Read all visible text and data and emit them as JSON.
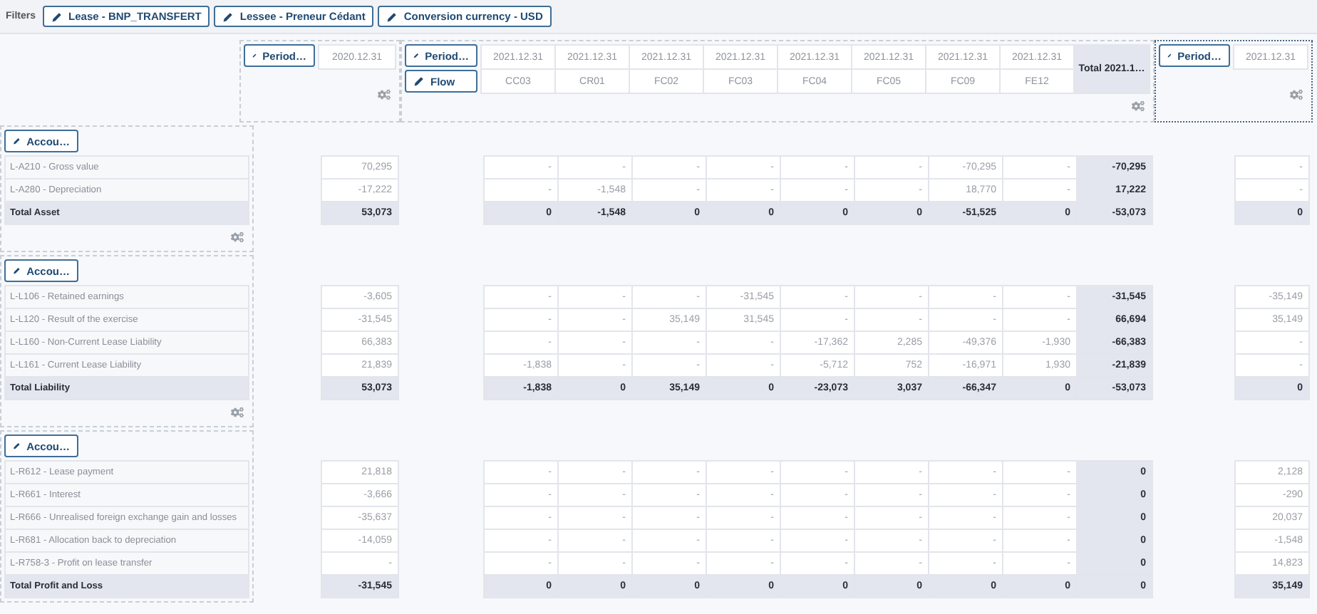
{
  "filters": {
    "label": "Filters",
    "chips": [
      {
        "label": "Lease - BNP_TRANSFERT"
      },
      {
        "label": "Lessee - Preneur Cédant"
      },
      {
        "label": "Conversion currency - USD"
      }
    ]
  },
  "column_header": {
    "block_a": {
      "buttons": [
        "Period…"
      ],
      "cells": [
        "2020.12.31"
      ],
      "selected": false
    },
    "block_b": {
      "buttons": [
        "Period…",
        "Flow"
      ],
      "columns": [
        {
          "period": "2021.12.31",
          "flow": "CC03"
        },
        {
          "period": "2021.12.31",
          "flow": "CR01"
        },
        {
          "period": "2021.12.31",
          "flow": "FC02"
        },
        {
          "period": "2021.12.31",
          "flow": "FC03"
        },
        {
          "period": "2021.12.31",
          "flow": "FC04"
        },
        {
          "period": "2021.12.31",
          "flow": "FC05"
        },
        {
          "period": "2021.12.31",
          "flow": "FC09"
        },
        {
          "period": "2021.12.31",
          "flow": "FE12"
        }
      ],
      "total": "Total 2021.1…",
      "selected": false
    },
    "block_c": {
      "buttons": [
        "Period…"
      ],
      "cells": [
        "2021.12.31"
      ],
      "selected": true
    }
  },
  "sections": [
    {
      "button": "Accou…",
      "settings_icon": true,
      "rows": [
        {
          "kind": "row",
          "label": "L-A210 - Gross value",
          "a": "70,295",
          "b": [
            "-",
            "-",
            "-",
            "-",
            "-",
            "-",
            "-70,295",
            "-"
          ],
          "total": "-70,295",
          "c": "-"
        },
        {
          "kind": "row",
          "label": "L-A280 - Depreciation",
          "a": "-17,222",
          "b": [
            "-",
            "-1,548",
            "-",
            "-",
            "-",
            "-",
            "18,770",
            "-"
          ],
          "total": "17,222",
          "c": "-"
        },
        {
          "kind": "total",
          "label": "Total Asset",
          "a": "53,073",
          "b": [
            "0",
            "-1,548",
            "0",
            "0",
            "0",
            "0",
            "-51,525",
            "0"
          ],
          "total": "-53,073",
          "c": "0"
        }
      ]
    },
    {
      "button": "Accou…",
      "settings_icon": true,
      "rows": [
        {
          "kind": "row",
          "label": "L-L106 - Retained earnings",
          "a": "-3,605",
          "b": [
            "-",
            "-",
            "-",
            "-31,545",
            "-",
            "-",
            "-",
            "-"
          ],
          "total": "-31,545",
          "c": "-35,149"
        },
        {
          "kind": "row",
          "label": "L-L120 - Result of the exercise",
          "a": "-31,545",
          "b": [
            "-",
            "-",
            "35,149",
            "31,545",
            "-",
            "-",
            "-",
            "-"
          ],
          "total": "66,694",
          "c": "35,149"
        },
        {
          "kind": "row",
          "label": "L-L160 - Non-Current Lease Liability",
          "a": "66,383",
          "b": [
            "-",
            "-",
            "-",
            "-",
            "-17,362",
            "2,285",
            "-49,376",
            "-1,930"
          ],
          "total": "-66,383",
          "c": "-"
        },
        {
          "kind": "row",
          "label": "L-L161 - Current Lease Liability",
          "a": "21,839",
          "b": [
            "-1,838",
            "-",
            "-",
            "-",
            "-5,712",
            "752",
            "-16,971",
            "1,930"
          ],
          "total": "-21,839",
          "c": "-"
        },
        {
          "kind": "total",
          "label": "Total Liability",
          "a": "53,073",
          "b": [
            "-1,838",
            "0",
            "35,149",
            "0",
            "-23,073",
            "3,037",
            "-66,347",
            "0"
          ],
          "total": "-53,073",
          "c": "0"
        }
      ]
    },
    {
      "button": "Accou…",
      "settings_icon": false,
      "rows": [
        {
          "kind": "row",
          "label": "L-R612 - Lease payment",
          "a": "21,818",
          "b": [
            "-",
            "-",
            "-",
            "-",
            "-",
            "-",
            "-",
            "-"
          ],
          "total": "0",
          "c": "2,128"
        },
        {
          "kind": "row",
          "label": "L-R661 - Interest",
          "a": "-3,666",
          "b": [
            "-",
            "-",
            "-",
            "-",
            "-",
            "-",
            "-",
            "-"
          ],
          "total": "0",
          "c": "-290"
        },
        {
          "kind": "row",
          "label": "L-R666 - Unrealised foreign exchange gain and losses",
          "a": "-35,637",
          "b": [
            "-",
            "-",
            "-",
            "-",
            "-",
            "-",
            "-",
            "-"
          ],
          "total": "0",
          "c": "20,037"
        },
        {
          "kind": "row",
          "label": "L-R681 - Allocation back to depreciation",
          "a": "-14,059",
          "b": [
            "-",
            "-",
            "-",
            "-",
            "-",
            "-",
            "-",
            "-"
          ],
          "total": "0",
          "c": "-1,548"
        },
        {
          "kind": "row",
          "label": "L-R758-3 - Profit on lease transfer",
          "a": "-",
          "b": [
            "-",
            "-",
            "-",
            "-",
            "-",
            "-",
            "-",
            "-"
          ],
          "total": "0",
          "c": "14,823"
        },
        {
          "kind": "total",
          "label": "Total Profit and Loss",
          "a": "-31,545",
          "b": [
            "0",
            "0",
            "0",
            "0",
            "0",
            "0",
            "0",
            "0"
          ],
          "total": "0",
          "c": "35,149"
        }
      ]
    }
  ]
}
